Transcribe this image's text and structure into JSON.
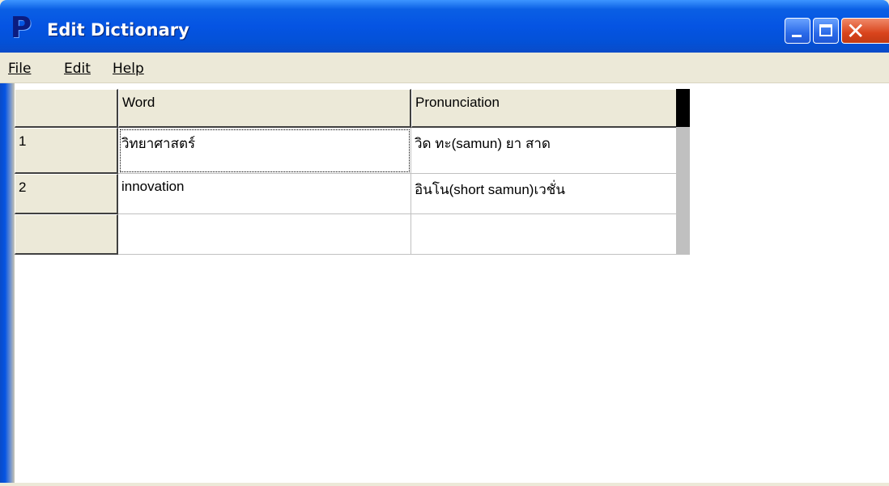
{
  "window": {
    "title": "Edit Dictionary",
    "icon_letter": "P"
  },
  "menu": {
    "file": "File",
    "edit": "Edit",
    "help": "Help"
  },
  "grid": {
    "columns": [
      "",
      "Word",
      "Pronunciation"
    ],
    "rows": [
      {
        "index": "1",
        "word": "วิทยาศาสตร์",
        "pronunciation": "วิด ทะ(samun) ยา สาด"
      },
      {
        "index": "2",
        "word": "innovation",
        "pronunciation": "อินโน(short samun)เวชั่น"
      },
      {
        "index": "",
        "word": "",
        "pronunciation": ""
      }
    ]
  },
  "colors": {
    "titlebar": "#0554e3",
    "chrome": "#ece9d8",
    "close_button": "#d9441c"
  }
}
